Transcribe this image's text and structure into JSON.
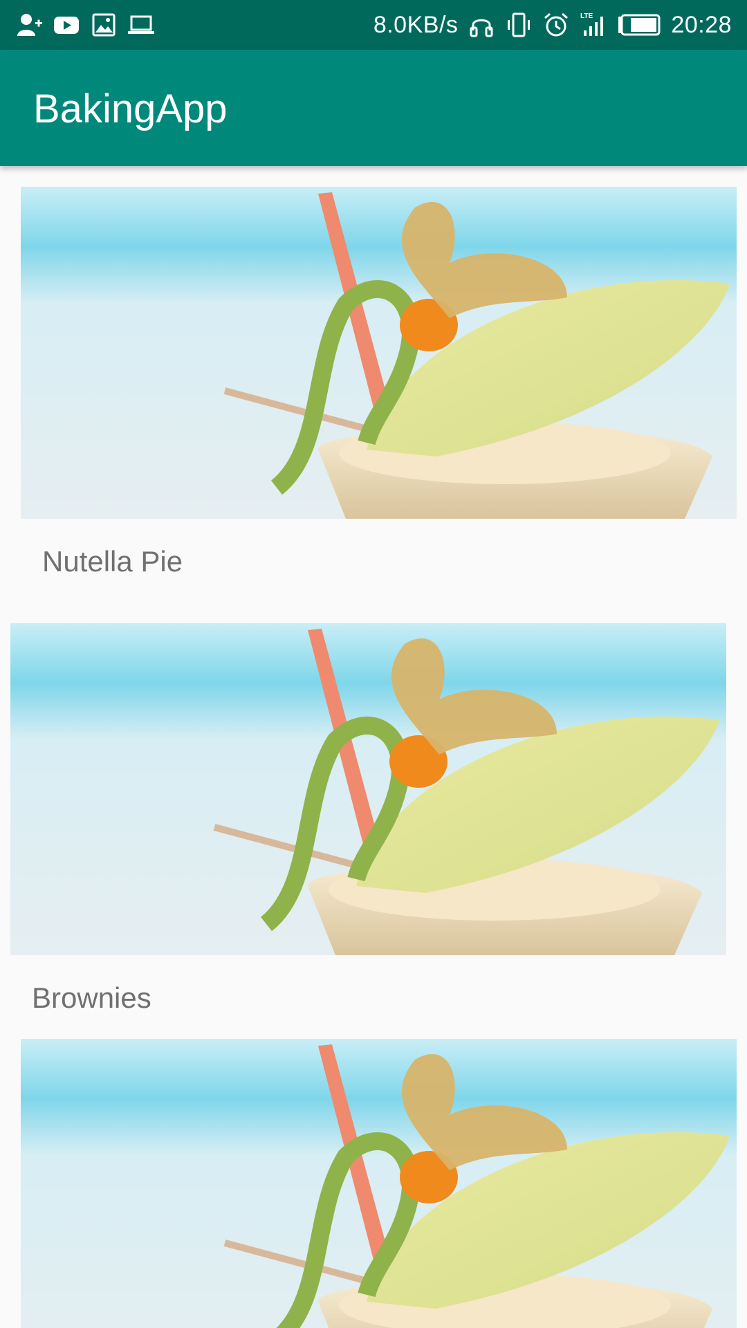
{
  "status_bar": {
    "left_icons": [
      "add-contact-icon",
      "youtube-icon",
      "gallery-icon",
      "laptop-icon"
    ],
    "speed": "8.0KB/s",
    "network_label": "LTE",
    "time": "20:28",
    "right_icons": [
      "headset-icon",
      "vibrate-icon",
      "alarm-icon",
      "signal-icon",
      "battery-icon"
    ]
  },
  "app_bar": {
    "title": "BakingApp"
  },
  "recipes": [
    {
      "name": "Nutella Pie",
      "image_icon": "melon-drink-image"
    },
    {
      "name": "Brownies",
      "image_icon": "melon-drink-image"
    },
    {
      "name": "",
      "image_icon": "melon-drink-image"
    }
  ],
  "colors": {
    "status_bar": "#00695c",
    "app_bar": "#00897b",
    "background": "#fafafa",
    "card_text": "#707070"
  }
}
